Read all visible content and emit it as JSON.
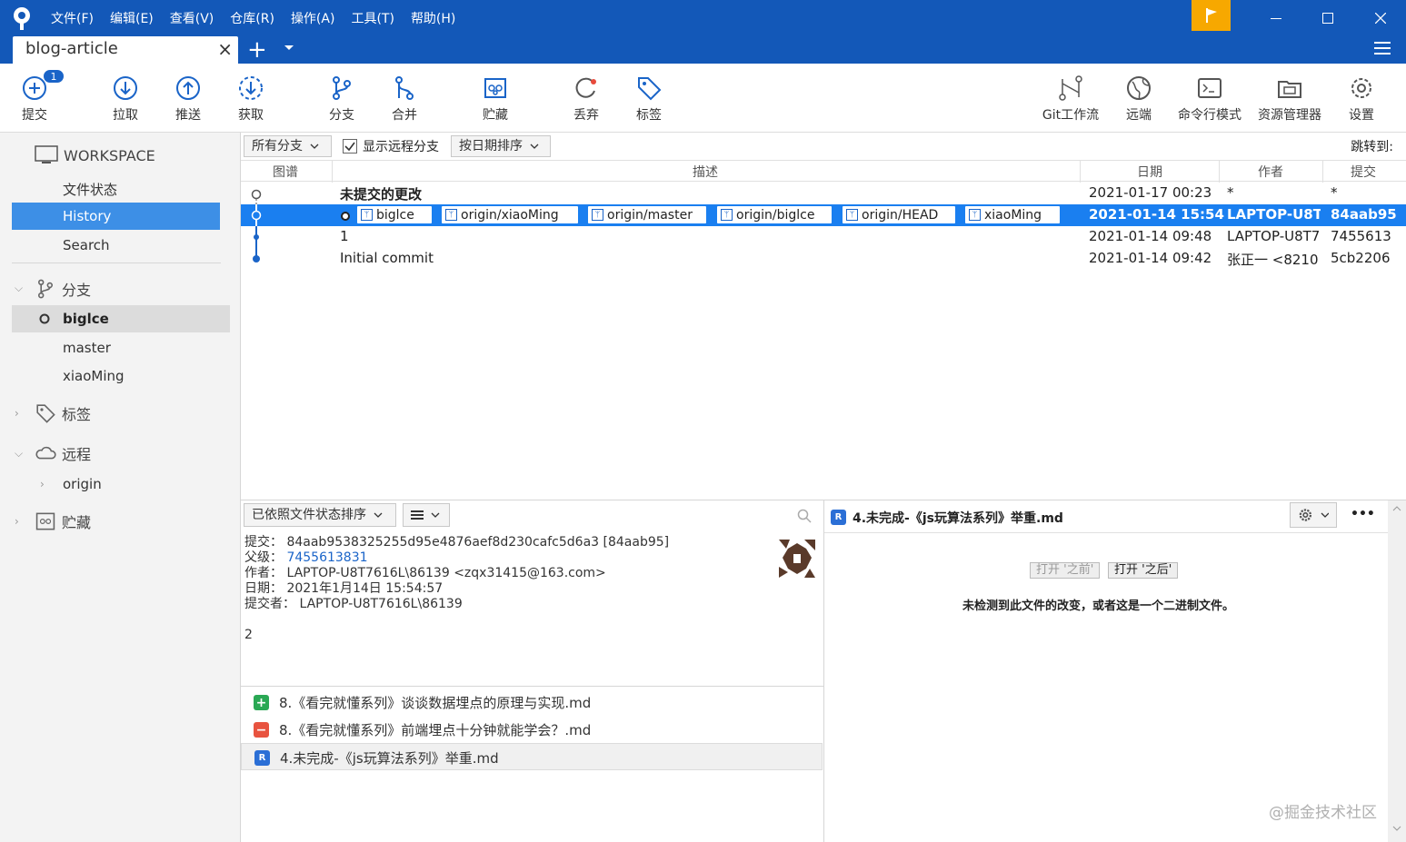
{
  "menu": [
    "文件(F)",
    "编辑(E)",
    "查看(V)",
    "仓库(R)",
    "操作(A)",
    "工具(T)",
    "帮助(H)"
  ],
  "tab": {
    "title": "blog-article",
    "close": "×",
    "add": "+"
  },
  "toolbar": {
    "commit": "提交",
    "commit_badge": "1",
    "pull": "拉取",
    "push": "推送",
    "fetch": "获取",
    "branch": "分支",
    "merge": "合并",
    "stash": "贮藏",
    "discard": "丢弃",
    "tag": "标签",
    "gitflow": "Git工作流",
    "remote": "远端",
    "terminal": "命令行模式",
    "explorer": "资源管理器",
    "settings": "设置"
  },
  "sidebar": {
    "workspace": "WORKSPACE",
    "file_status": "文件状态",
    "history": "History",
    "search": "Search",
    "branches": "分支",
    "branch_items": [
      "biglce",
      "master",
      "xiaoMing"
    ],
    "tags": "标签",
    "remotes": "远程",
    "remote_items": [
      "origin"
    ],
    "stashes": "贮藏"
  },
  "filter": {
    "all_branches": "所有分支",
    "show_remote": "显示远程分支",
    "sort_by_date": "按日期排序",
    "jump_to": "跳转到:"
  },
  "history": {
    "headers": {
      "graph": "图谱",
      "description": "描述",
      "date": "日期",
      "author": "作者",
      "commit": "提交"
    },
    "rows": [
      {
        "desc": "未提交的更改",
        "date": "2021-01-17 00:23",
        "author": "*",
        "commit": "*"
      },
      {
        "desc": "",
        "date": "2021-01-14 15:54",
        "author": "LAPTOP-U8T",
        "commit": "84aab95"
      },
      {
        "desc": "1",
        "date": "2021-01-14 09:48",
        "author": "LAPTOP-U8T7",
        "commit": "7455613"
      },
      {
        "desc": "Initial commit",
        "date": "2021-01-14 09:42",
        "author": "张正一 <8210",
        "commit": "5cb2206"
      }
    ],
    "refs": [
      "biglce",
      "origin/xiaoMing",
      "origin/master",
      "origin/biglce",
      "origin/HEAD",
      "xiaoMing"
    ]
  },
  "detail": {
    "sort_label": "已依照文件状态排序",
    "commit_label": "提交：",
    "commit_value": "84aab9538325255d95e4876aef8d230cafc5d6a3 [84aab95]",
    "parent_label": "父级：",
    "parent_value": "7455613831",
    "author_label": "作者：",
    "author_value": "LAPTOP-U8T7616L\\86139 <zqx31415@163.com>",
    "date_label": "日期：",
    "date_value": "2021年1月14日 15:54:57",
    "committer_label": "提交者：",
    "committer_value": "LAPTOP-U8T7616L\\86139",
    "message": "2"
  },
  "files": [
    {
      "status": "added",
      "name": "8.《看完就懂系列》谈谈数据埋点的原理与实现.md"
    },
    {
      "status": "removed",
      "name": "8.《看完就懂系列》前端埋点十分钟就能学会？.md"
    },
    {
      "status": "renamed",
      "name": "4.未完成-《js玩算法系列》举重.md"
    }
  ],
  "diff": {
    "file_title": "4.未完成-《js玩算法系列》举重.md",
    "open_before": "打开 '之前'",
    "open_after": "打开 '之后'",
    "message": "未检测到此文件的改变，或者这是一个二进制文件。",
    "more": "•••"
  },
  "watermark": "@掘金技术社区"
}
